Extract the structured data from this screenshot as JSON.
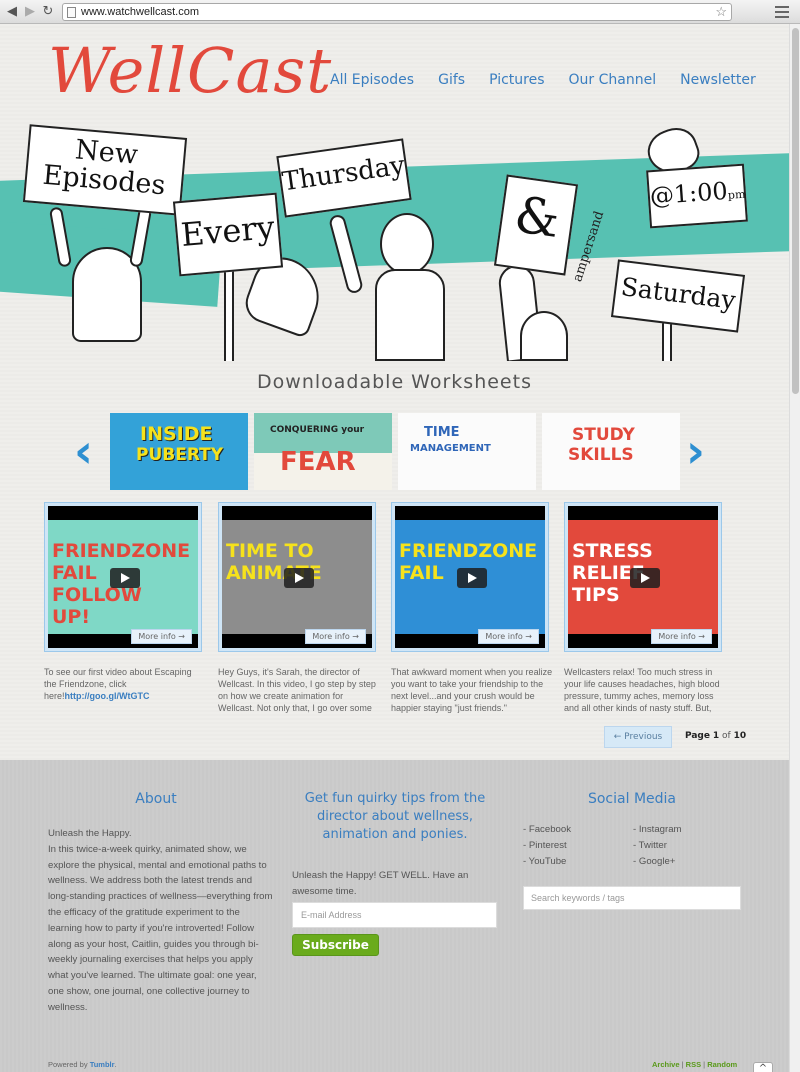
{
  "browser": {
    "url": "www.watchwellcast.com",
    "back_glyph": "◀",
    "forward_glyph": "▶",
    "reload_glyph": "↻",
    "star_glyph": "☆"
  },
  "site": {
    "logo": "WellCast",
    "nav": [
      "All Episodes",
      "Gifs",
      "Pictures",
      "Our Channel",
      "Newsletter"
    ]
  },
  "hero": {
    "sign_new": "New",
    "sign_episodes": "Episodes",
    "sign_every": "Every",
    "sign_thursday": "Thursday",
    "sign_amp": "&",
    "note_ampersand": "ampersand",
    "sign_time": "@1:00",
    "sign_pm": "pm",
    "sign_saturday": "Saturday"
  },
  "worksheets": {
    "title": "Downloadable Worksheets",
    "prev_arrow": "‹",
    "next_arrow": "›",
    "items": [
      {
        "line1": "INSIDE",
        "line2": "PUBERTY"
      },
      {
        "line1": "CONQUERING your",
        "line2": "FEAR"
      },
      {
        "line1": "TIME",
        "line2": "MANAGEMENT"
      },
      {
        "line1": "STUDY",
        "line2": "SKILLS"
      }
    ]
  },
  "videos": [
    {
      "title": "FRIENDZONE FAIL FOLLOW UP!",
      "more": "More info →",
      "desc": "To see our first video about Escaping the Friendzone, click here!",
      "link": "http://goo.gl/WtGTC"
    },
    {
      "title": "TIME TO ANIMATE",
      "more": "More info →",
      "desc": "Hey Guys, it's Sarah, the director of Wellcast.  In this video, I go step by step on how we create animation for Wellcast. Not only that, I go over some",
      "link": ""
    },
    {
      "title": "FRIENDZONE FAIL",
      "more": "More info →",
      "desc": "That awkward moment when you realize you want to take your friendship to the next level...and your crush would be happier staying \"just friends.\"",
      "link": ""
    },
    {
      "title": "STRESS RELIEF TIPS",
      "more": "More info →",
      "desc": "Wellcasters relax! Too much stress in your life causes headaches, high blood pressure, tummy aches, memory loss and all other kinds of nasty stuff. But,",
      "link": ""
    }
  ],
  "pagination": {
    "prev": "← Previous",
    "page_label": "Page",
    "current": "1",
    "of_label": "of",
    "total": "10"
  },
  "footer": {
    "about_heading": "About",
    "about_text": "Unleash the Happy.\nIn this twice-a-week quirky, animated show, we explore the physical, mental and emotional paths to wellness. We address both the latest trends and long-standing practices of wellness—everything from the efficacy of the gratitude experiment to the learning how to party if you're introverted! Follow along as your host, Caitlin, guides you through bi-weekly journaling exercises that helps you apply what you've learned. The ultimate goal: one year, one show, one journal, one collective journey to wellness.",
    "newsletter_heading": "Get fun quirky tips from the director about wellness, animation and ponies.",
    "newsletter_text": "Unleash the Happy! GET WELL. Have an awesome time.",
    "email_placeholder": "E-mail Address",
    "subscribe_label": "Subscribe",
    "social_heading": "Social Media",
    "social_left": [
      "- Facebook",
      "- Pinterest",
      "- YouTube"
    ],
    "social_right": [
      "- Instagram",
      "- Twitter",
      "- Google+"
    ],
    "search_placeholder": "Search keywords / tags",
    "powered_prefix": "Powered by",
    "powered_brand": "Tumblr",
    "powered_suffix": ".",
    "links": [
      "Archive",
      "RSS",
      "Random"
    ],
    "link_sep": "|",
    "to_top": "^"
  },
  "colors": {
    "brand_red": "#e2493c",
    "link_blue": "#3a7ec0",
    "teal_brush": "#57c1b2",
    "subscribe_green": "#6aab1c"
  }
}
